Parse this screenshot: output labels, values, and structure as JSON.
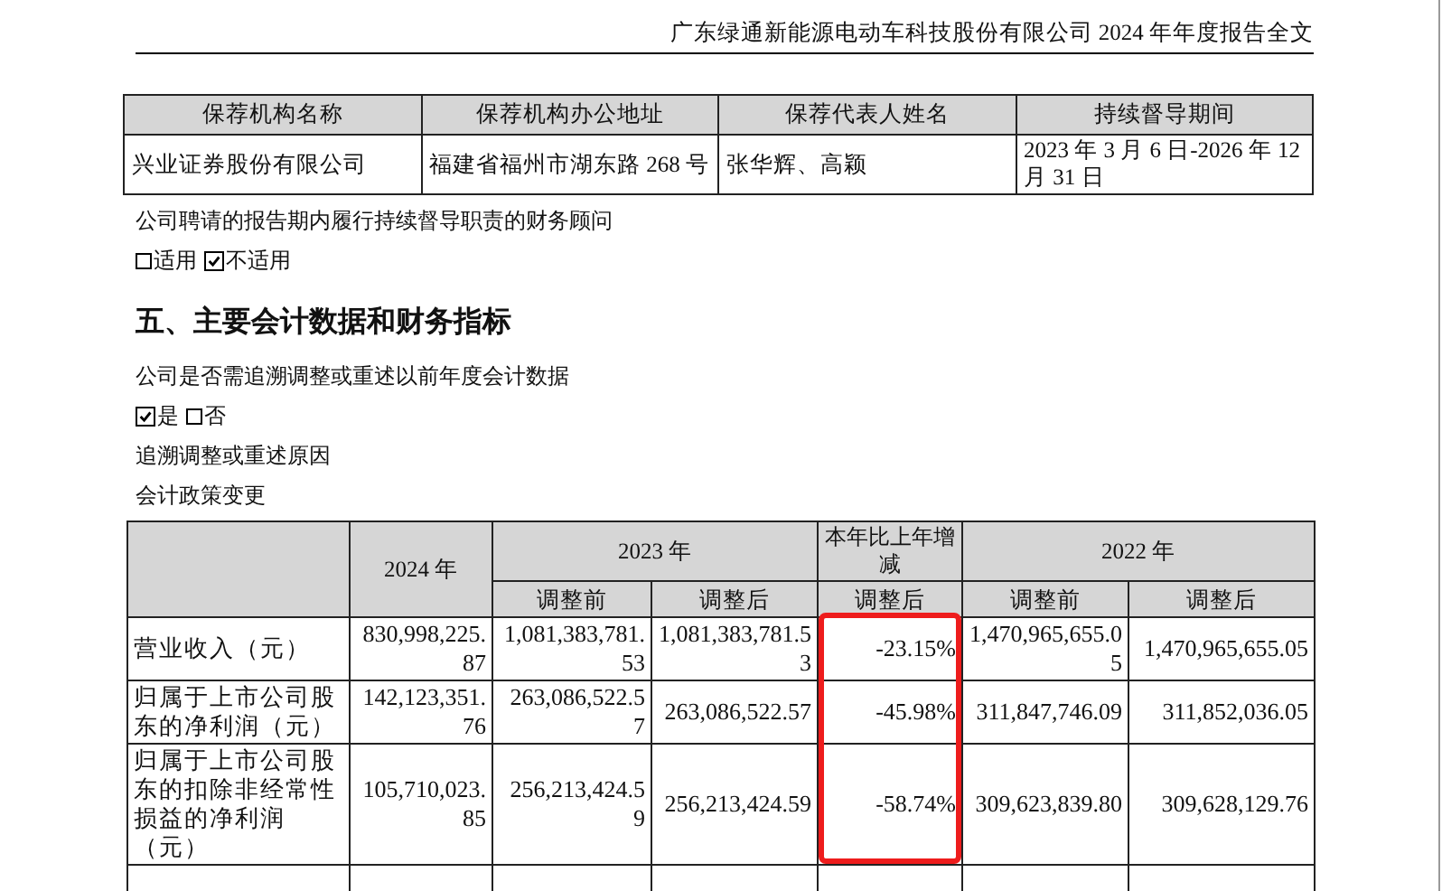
{
  "page_header": "广东绿通新能源电动车科技股份有限公司 2024 年年度报告全文",
  "sponsor_table": {
    "columns": [
      "保荐机构名称",
      "保荐机构办公地址",
      "保荐代表人姓名",
      "持续督导期间"
    ],
    "rows": [
      [
        "兴业证券股份有限公司",
        "福建省福州市湖东路 268 号",
        "张华辉、高颖",
        "2023 年 3 月 6 日-2026 年 12 月 31 日"
      ]
    ]
  },
  "advisor_note": "公司聘请的报告期内履行持续督导职责的财务顾问",
  "advisor_options": [
    {
      "label": "适用",
      "checked": false
    },
    {
      "label": "不适用",
      "checked": true
    }
  ],
  "section_title": "五、主要会计数据和财务指标",
  "restate_question": "公司是否需追溯调整或重述以前年度会计数据",
  "restate_options": [
    {
      "label": "是",
      "checked": true
    },
    {
      "label": "否",
      "checked": false
    }
  ],
  "reason_label": "追溯调整或重述原因",
  "reason_value": "会计政策变更",
  "finance_table": {
    "year_headers": [
      "2024 年",
      "2023 年",
      "本年比上年增减",
      "2022 年"
    ],
    "sub_headers": [
      "调整前",
      "调整后",
      "调整后",
      "调整前",
      "调整后"
    ],
    "rows": [
      {
        "label": "营业收入（元）",
        "values": [
          "830,998,225.87",
          "1,081,383,781.53",
          "1,081,383,781.53",
          "-23.15%",
          "1,470,965,655.05",
          "1,470,965,655.05"
        ]
      },
      {
        "label": "归属于上市公司股东的净利润（元）",
        "values": [
          "142,123,351.76",
          "263,086,522.57",
          "263,086,522.57",
          "-45.98%",
          "311,847,746.09",
          "311,852,036.05"
        ]
      },
      {
        "label": "归属于上市公司股东的扣除非经常性损益的净利润（元）",
        "values": [
          "105,710,023.85",
          "256,213,424.59",
          "256,213,424.59",
          "-58.74%",
          "309,623,839.80",
          "309,628,129.76"
        ]
      }
    ],
    "change_column_highlighted": true
  }
}
